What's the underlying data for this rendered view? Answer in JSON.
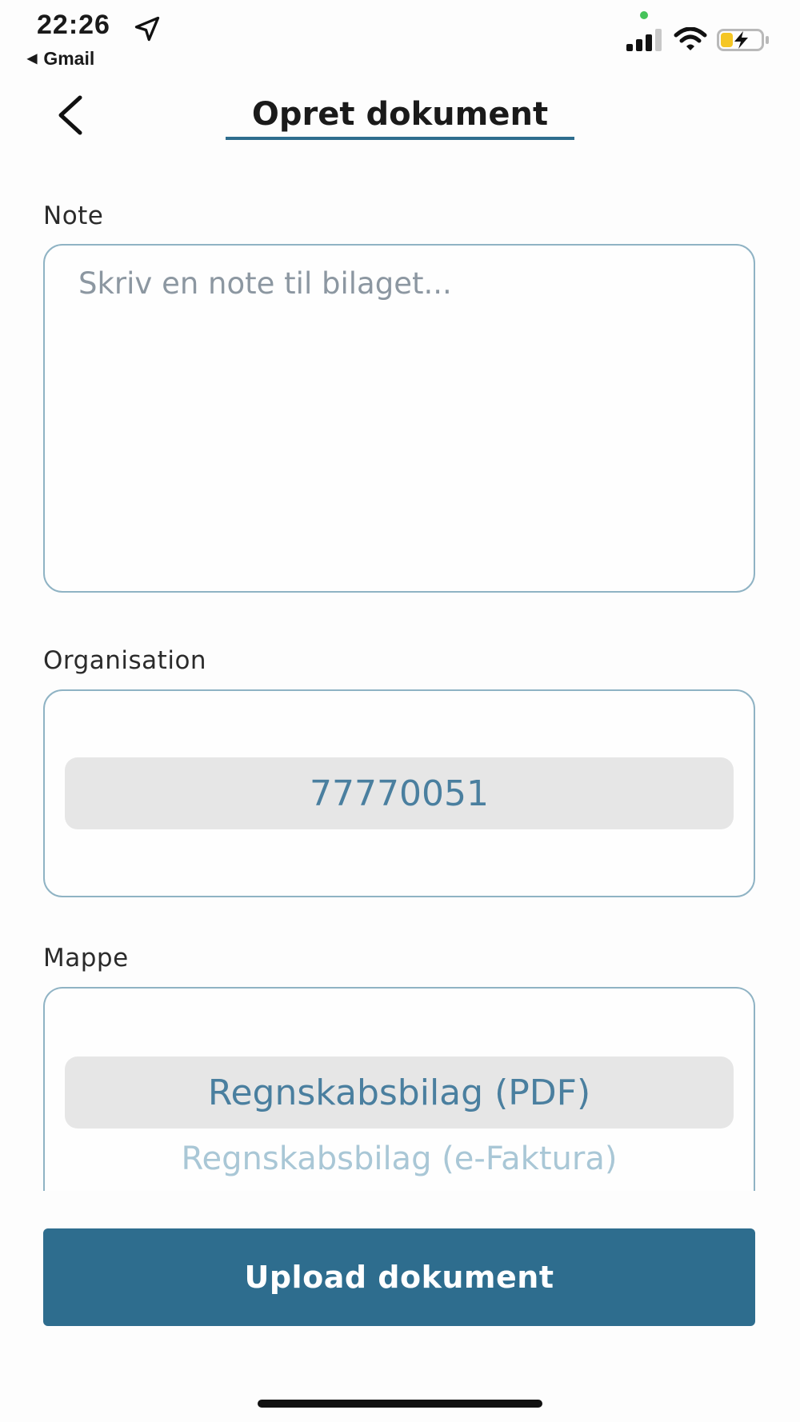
{
  "status_bar": {
    "time": "22:26",
    "back_app": "Gmail",
    "back_arrow": "◀",
    "icons": [
      "location-arrow-icon",
      "signal-icon",
      "wifi-icon",
      "battery-charging-icon"
    ],
    "battery_level": 0.3
  },
  "header": {
    "back_icon": "chevron-left-icon",
    "title": "Opret dokument"
  },
  "note": {
    "label": "Note",
    "value": "",
    "placeholder": "Skriv en note til bilaget..."
  },
  "organisation": {
    "label": "Organisation",
    "selected": "77770051"
  },
  "mappe": {
    "label": "Mappe",
    "selected": "Regnskabsbilag (PDF)",
    "next_option": "Regnskabsbilag (e-Faktura)"
  },
  "upload_button": {
    "label": "Upload dokument"
  },
  "colors": {
    "accent": "#2e6d8e",
    "border": "#8fb3c4",
    "picker_text": "#4a7f9f",
    "picker_faded": "#a9c7d6",
    "picker_highlight": "#e6e6e6"
  }
}
